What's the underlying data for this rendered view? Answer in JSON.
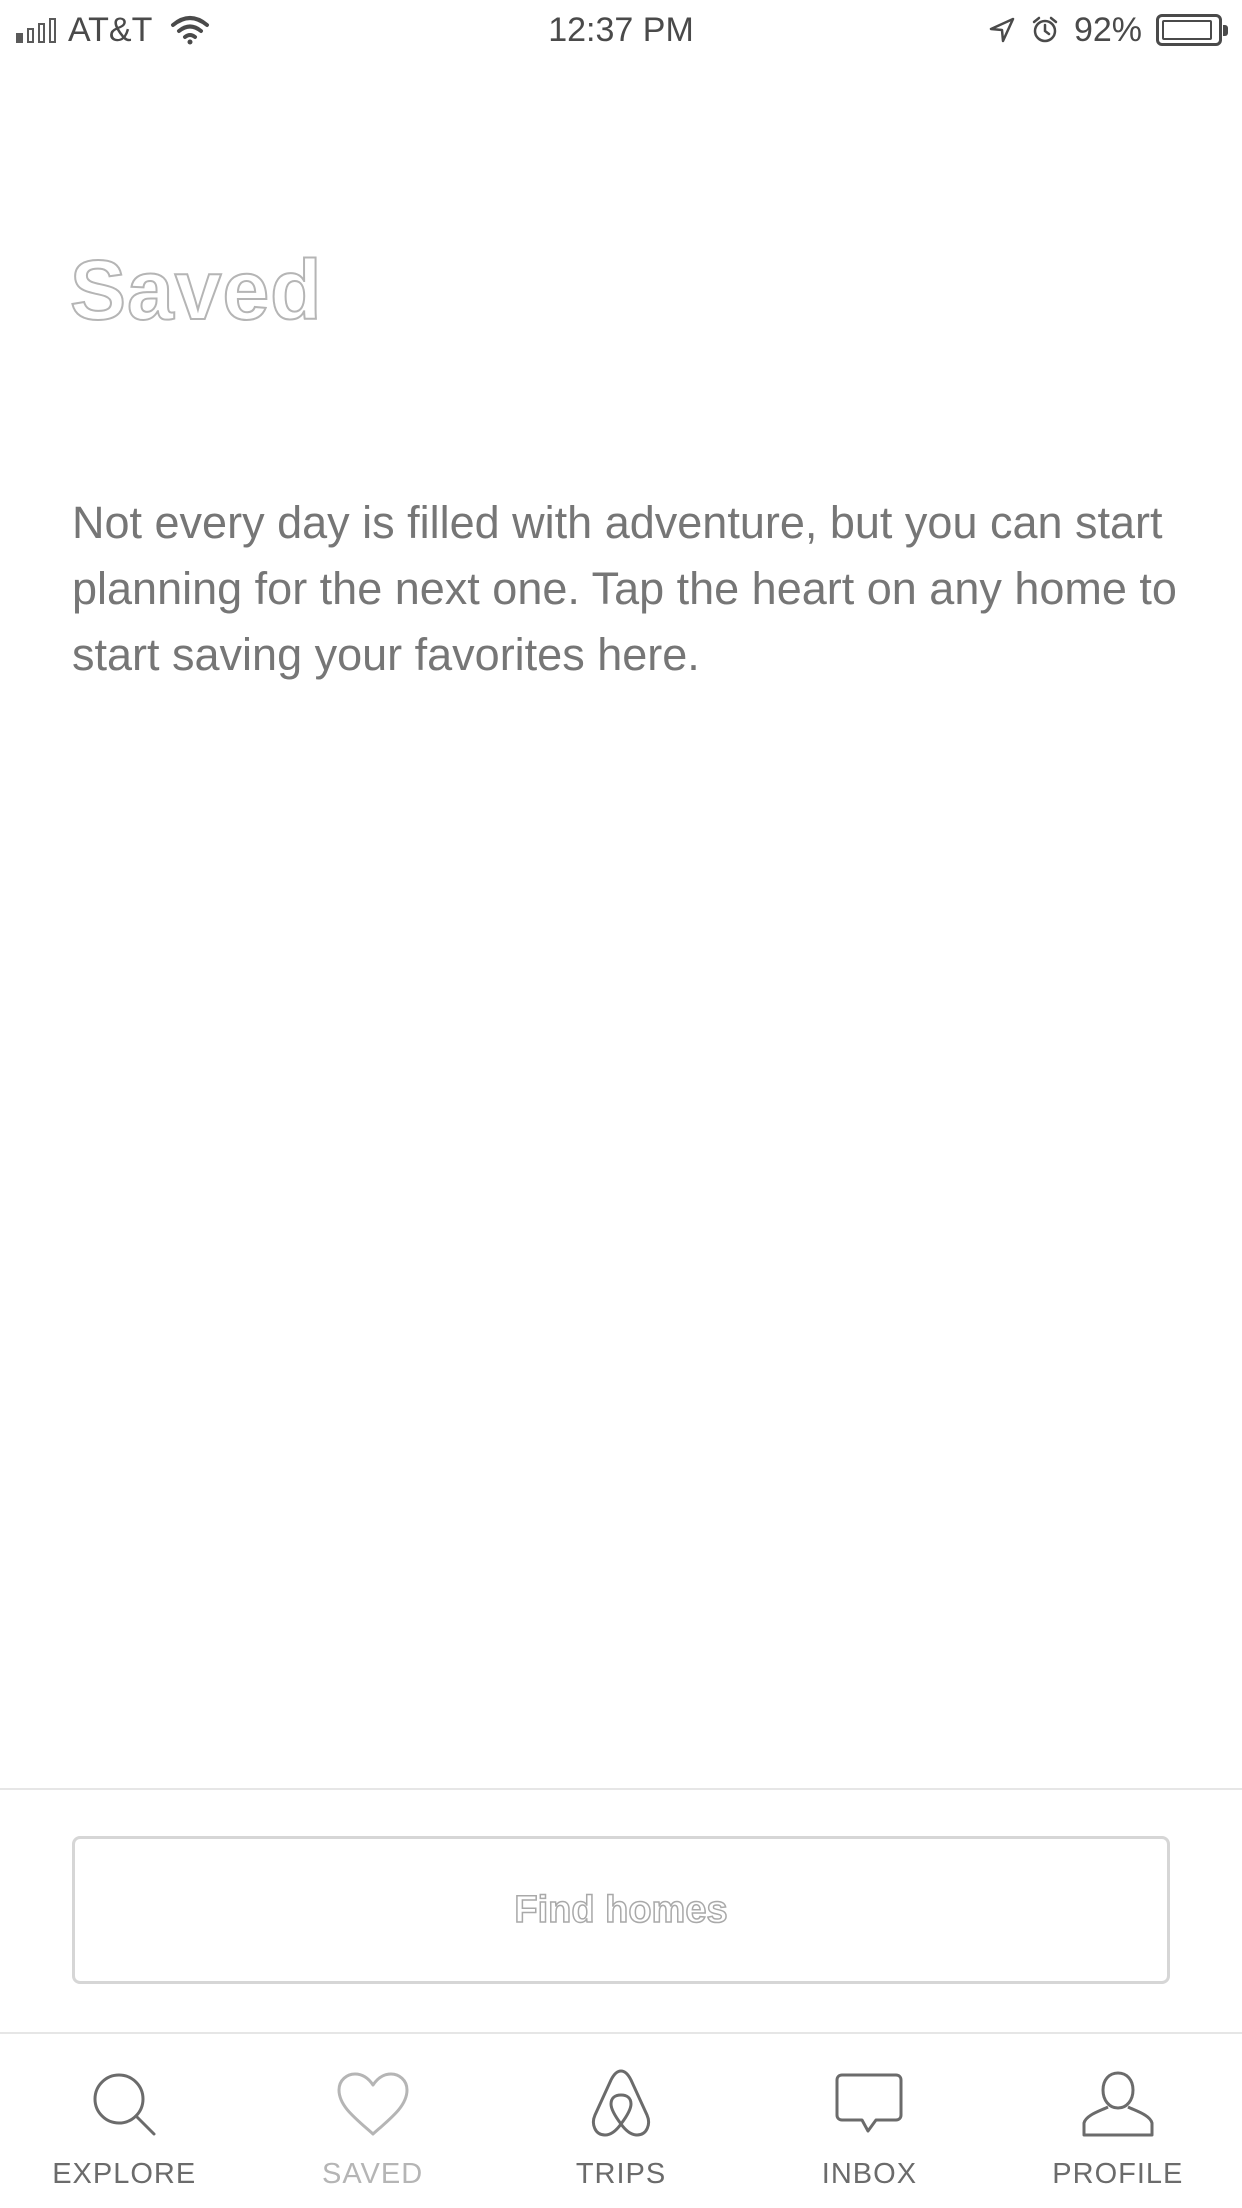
{
  "status_bar": {
    "carrier": "AT&T",
    "time": "12:37 PM",
    "battery": "92%",
    "icons": [
      "signal-icon",
      "wifi-icon",
      "location-arrow-icon",
      "alarm-icon",
      "battery-icon"
    ]
  },
  "page": {
    "title": "Saved",
    "message": "Not every day is filled with adventure, but you can start planning for the next one. Tap the heart on any home to start saving your favorites here."
  },
  "actions": {
    "find_homes_label": "Find homes"
  },
  "tabs": [
    {
      "label": "EXPLORE",
      "icon": "search-icon",
      "active": false
    },
    {
      "label": "SAVED",
      "icon": "heart-icon",
      "active": true
    },
    {
      "label": "TRIPS",
      "icon": "airbnb-logo-icon",
      "active": false
    },
    {
      "label": "INBOX",
      "icon": "message-bubble-icon",
      "active": false
    },
    {
      "label": "PROFILE",
      "icon": "person-icon",
      "active": false
    }
  ],
  "colors": {
    "text": "#767676",
    "inactive_outline": "#b5b5b5",
    "divider": "#e6e6e6"
  }
}
